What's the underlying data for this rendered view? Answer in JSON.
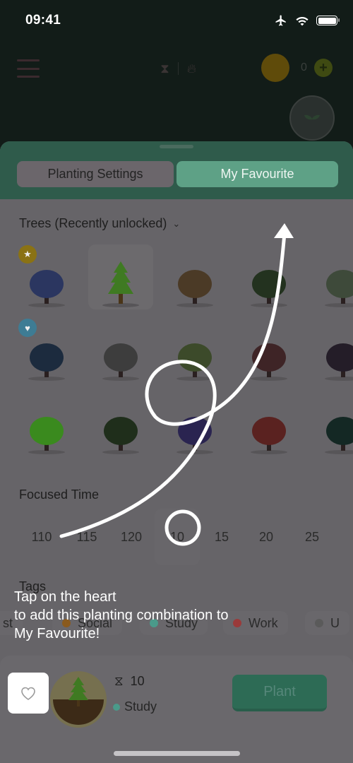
{
  "status_bar": {
    "time": "09:41",
    "icons": [
      "airplane-icon",
      "wifi-icon",
      "battery-icon"
    ]
  },
  "top_bar": {
    "icons": [
      "menu-icon",
      "hourglass-icon",
      "flame-icon",
      "coin-icon",
      "plus-icon",
      "sprout-icon"
    ],
    "coin_count": "0",
    "plus_label": "+"
  },
  "sheet": {
    "tabs": [
      {
        "label": "Planting Settings",
        "active": false
      },
      {
        "label": "My Favourite",
        "active": true
      }
    ],
    "trees_section": {
      "title": "Trees (Recently unlocked)",
      "chevron": "⌄",
      "items": [
        {
          "name": "coral-tree",
          "badge": "star"
        },
        {
          "name": "pine-tree",
          "selected": true
        },
        {
          "name": "angel-rock"
        },
        {
          "name": "rose-bush"
        },
        {
          "name": "partial-tree-1"
        },
        {
          "name": "planet-tree",
          "badge": "heart"
        },
        {
          "name": "flower-bunch"
        },
        {
          "name": "grass-bush"
        },
        {
          "name": "maple-tree"
        },
        {
          "name": "mushroom-tree"
        },
        {
          "name": "green-bush"
        },
        {
          "name": "fruit-bush"
        },
        {
          "name": "lavender"
        },
        {
          "name": "tulips"
        },
        {
          "name": "dark-tree"
        }
      ]
    },
    "focused_time": {
      "title": "Focused Time",
      "ticks": [
        "110",
        "115",
        "120",
        "10",
        "15",
        "20",
        "25"
      ],
      "selected": "10"
    },
    "tags": {
      "title": "Tags",
      "items": [
        {
          "label": "st",
          "color": ""
        },
        {
          "label": "Social",
          "color": "#8a5a1e"
        },
        {
          "label": "Study",
          "color": "#4a9a8a"
        },
        {
          "label": "Work",
          "color": "#9a3a3a"
        },
        {
          "label": "U",
          "color": "#5a5a5a"
        }
      ]
    }
  },
  "bottom_panel": {
    "favourite_icon": "heart-icon",
    "time_value": "10",
    "tag_label": "Study",
    "tag_color": "#4a9a8a",
    "plant_label": "Plant"
  },
  "tutorial": {
    "text": "Tap on the heart\nto add this planting combination to\nMy Favourite!"
  }
}
